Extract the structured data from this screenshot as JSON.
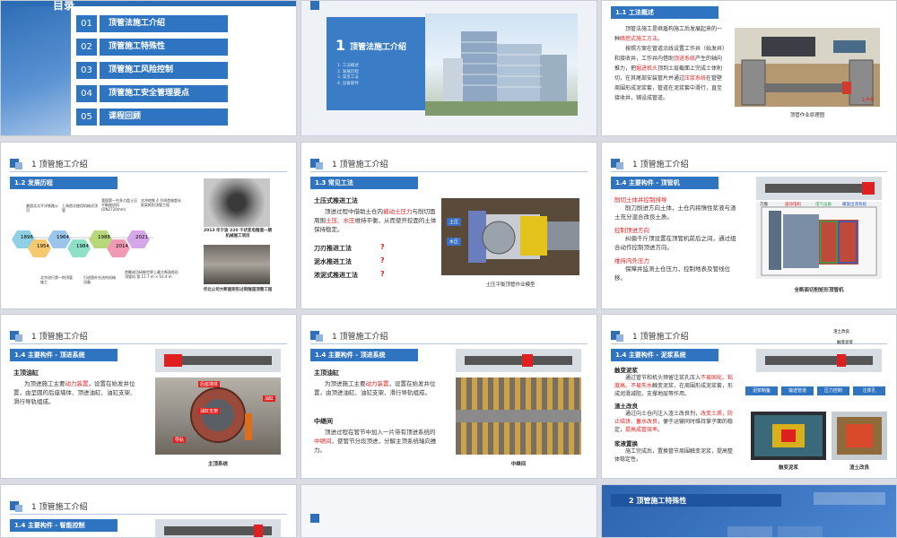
{
  "toc": {
    "title": "目录",
    "subtitle": "CONTENTS",
    "items": [
      {
        "num": "01",
        "label": "顶管法施工介绍"
      },
      {
        "num": "02",
        "label": "顶管施工特殊性"
      },
      {
        "num": "03",
        "label": "顶管施工风险控制"
      },
      {
        "num": "04",
        "label": "顶管施工安全管理要点"
      },
      {
        "num": "05",
        "label": "课程回顾"
      }
    ]
  },
  "section1": {
    "num": "1",
    "title": "顶管法施工介绍",
    "subitems": [
      "1. 工法概述",
      "2. 发展历程",
      "3. 常见工法",
      "4. 设备部件"
    ]
  },
  "s_overview": {
    "tag": "1.1 工法概述",
    "p1_a": "顶管法施工是继盾构施工后发展起来的一种",
    "p1_red": "暗挖式施工方法",
    "p1_b": "。",
    "p2_a": "按照方案在管道沿线设置工作井（始发井）和接收井，工作井内借助",
    "p2_red1": "顶进系统",
    "p2_b": "产生的轴向推力，把",
    "p2_red2": "掘进机头",
    "p2_c": "顶到土层截面上完成土体削切，在其尾部安装管片并通过",
    "p2_red3": "压浆系统",
    "p2_d": "在管壁周围形成泥浆套，管道在泥浆套中滑行，直至接收井，铺设成管道。",
    "caption": "顶管作业原理图",
    "label_well": "工作井"
  },
  "header_title": "1 顶管施工介绍",
  "s_history": {
    "tag": "1.2 发展历程",
    "years_top": [
      "1896",
      "1964",
      "1988",
      "2021"
    ],
    "years_bottom": [
      "1954",
      "1984",
      "2014"
    ],
    "notes_top": [
      "美国北太平洋铁路公司",
      "上海首次使用机械式顶管",
      "我国第一台多刀盘土压平衡掘进机(DN2720mm)",
      "文冲地铁 4 号线首座超长距离矩形顶管工程"
    ],
    "notes_bottom": [
      "北京进行第一例顶管施工",
      "引进国外先进的机械设备",
      "首颗成功研制世界上最大断面矩形顶管机 宽 11.7 m × 10.4 m"
    ],
    "cap1": "2013 年宁波 220 千伏变电隧道一期机械施工项目",
    "cap2": "华北公司大断面矩形过街隧道顶管工程"
  },
  "s_methods": {
    "tag": "1.3 常见工法",
    "m1": "土压式推进工法",
    "m1_a": "顶进过程中借助土仓内",
    "m1_red1": "被动土压力",
    "m1_b": "与削切面周围",
    "m1_red2": "土压、水压",
    "m1_c": "维持平衡，从而使开挖面的土体保持稳定。",
    "m2": "刀刃推进工法",
    "m3": "泥水推进工法",
    "m4": "浓泥式推进工法",
    "q": "?",
    "caption": "土压平衡顶管作业模型",
    "lbl1": "土压",
    "lbl2": "水压"
  },
  "s_machine": {
    "tag": "1.4 主要构件 - 顶管机",
    "r1": "削切土体并控制排导",
    "t1": "削刀削进方向土体，土仓内将惰性浆液与渣土充分混合改良土质。",
    "r2": "控制顶进方向",
    "t2": "纠偏千斤顶设置在顶管机前后之间，通过组合动作控制顶进方向。",
    "r3": "维持内外压力",
    "t3": "保障并监测土仓压力，控制地表及管线位移。",
    "caption": "全断面切削矩形顶管机",
    "labels": [
      "刀盘",
      "驱动电机",
      "电气设备",
      "螺旋出渣系统"
    ]
  },
  "s_jack1": {
    "tag": "1.4 主要构件 - 顶进系统",
    "h": "主顶油缸",
    "t_a": "为顶进施工主要",
    "t_red": "动力装置",
    "t_b": "，设置在始发井位置，由呈圆的后座墙体、顶进油缸、油缸支架、滑行导轨组成。",
    "caption": "主顶系统",
    "lbl_wall": "后座墙体",
    "lbl_cyl": "油缸支架",
    "lbl_oil": "油缸",
    "lbl_rail": "导轨"
  },
  "s_jack2": {
    "tag": "1.4 主要构件 - 顶进系统",
    "h": "主顶油缸",
    "t_a": "为顶进施工主要",
    "t_red": "动力装置",
    "t_b": "，设置在始发井位置，由顶进油缸、油缸支架、滑行导轨组成。",
    "h2": "中继间",
    "t2_a": "顶进过程在管节中加入一片带有顶进系统的",
    "t2_red": "中继间",
    "t2_b": "，使管节分段顶进，分解主顶系统轴向推力。",
    "caption": "中继间"
  },
  "s_mud": {
    "tag": "1.4 主要构件 - 泥浆系统",
    "h1": "触变泥浆",
    "t1_a": "通过管节和机头预留注浆孔压入",
    "t1_red": "不易固化、粘度高、不易失水",
    "t1_b": "触变泥浆，在周围形成泥浆套，形成润滑减阻，支撑地层等作用。",
    "h2": "渣土改良",
    "t2_a": "通过向土仓内注入渣土改良剂，",
    "t2_red": "改变土质，防止结饼、蓄水改良",
    "t2_b": "，便于运输同时维持掌子面的稳定，",
    "t2_red2": "提高成管效率",
    "t2_c": "。",
    "h3": "浆液置换",
    "t3": "施工完成后，置换管节周围触变泥浆，提高整体稳定性。",
    "btns": [
      "泥浆制备",
      "输送管道",
      "压力控制",
      "注浆孔"
    ],
    "top_lbls": [
      "渣土改良",
      "触变泥浆"
    ],
    "cap1": "触变泥浆",
    "cap2": "渣土改良"
  },
  "s_smart": {
    "tag": "1.4 主要构件 - 智能控制"
  },
  "section2": {
    "title": "2 顶管施工特殊性"
  }
}
